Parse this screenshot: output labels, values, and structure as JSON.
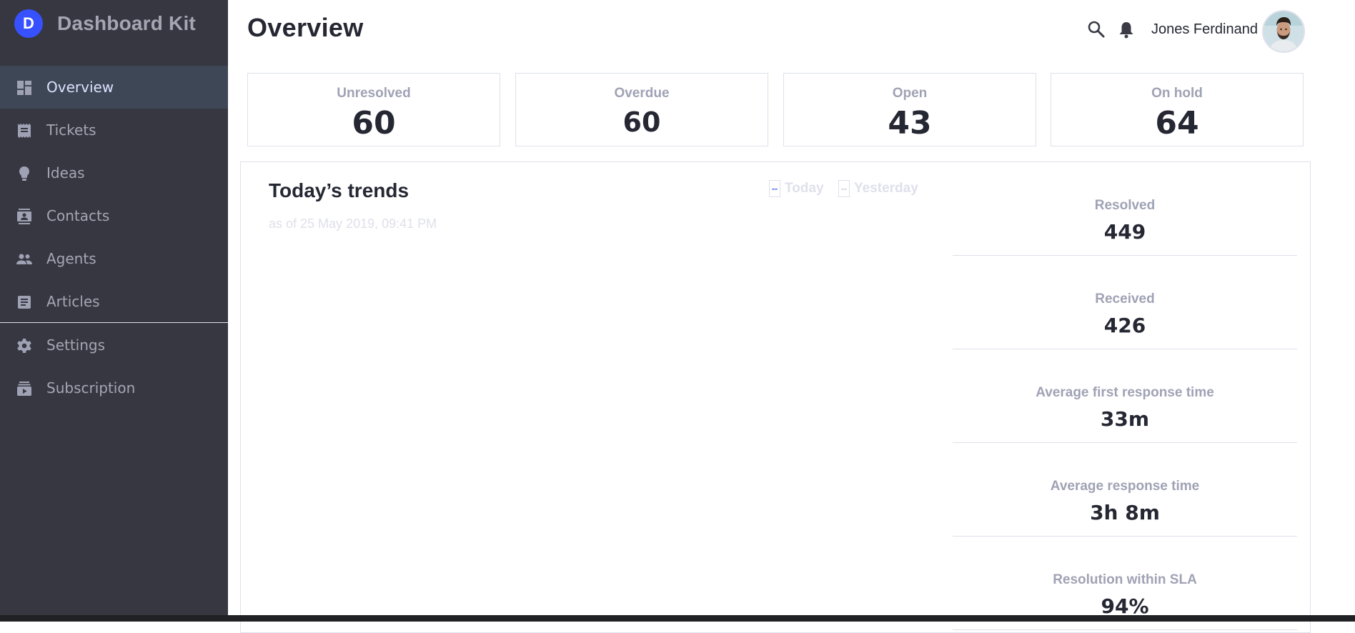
{
  "brand": {
    "name": "Dashboard Kit",
    "logo_letter": "D",
    "accent": "#3751ff"
  },
  "sidebar": {
    "items": [
      {
        "label": "Overview",
        "icon": "dashboard-icon",
        "active": true
      },
      {
        "label": "Tickets",
        "icon": "ticket-icon"
      },
      {
        "label": "Ideas",
        "icon": "lightbulb-icon"
      },
      {
        "label": "Contacts",
        "icon": "contacts-icon"
      },
      {
        "label": "Agents",
        "icon": "people-icon"
      },
      {
        "label": "Articles",
        "icon": "article-icon"
      },
      {
        "label": "Settings",
        "icon": "gear-icon"
      },
      {
        "label": "Subscription",
        "icon": "subscription-icon"
      }
    ]
  },
  "header": {
    "title": "Overview",
    "user_name": "Jones Ferdinand"
  },
  "stats": [
    {
      "label": "Unresolved",
      "value": "60"
    },
    {
      "label": "Overdue",
      "value": "60"
    },
    {
      "label": "Open",
      "value": "43"
    },
    {
      "label": "On hold",
      "value": "64"
    }
  ],
  "trends": {
    "title": "Today’s trends",
    "subtitle": "as of 25 May 2019, 09:41 PM",
    "legend": [
      {
        "label": "Today",
        "color": "#3751ff"
      },
      {
        "label": "Yesterday",
        "color": "#c5c7d1"
      }
    ],
    "metrics": [
      {
        "label": "Resolved",
        "value": "449"
      },
      {
        "label": "Received",
        "value": "426"
      },
      {
        "label": "Average first response time",
        "value": "33m"
      },
      {
        "label": "Average response time",
        "value": "3h 8m"
      },
      {
        "label": "Resolution within SLA",
        "value": "94%"
      }
    ]
  }
}
